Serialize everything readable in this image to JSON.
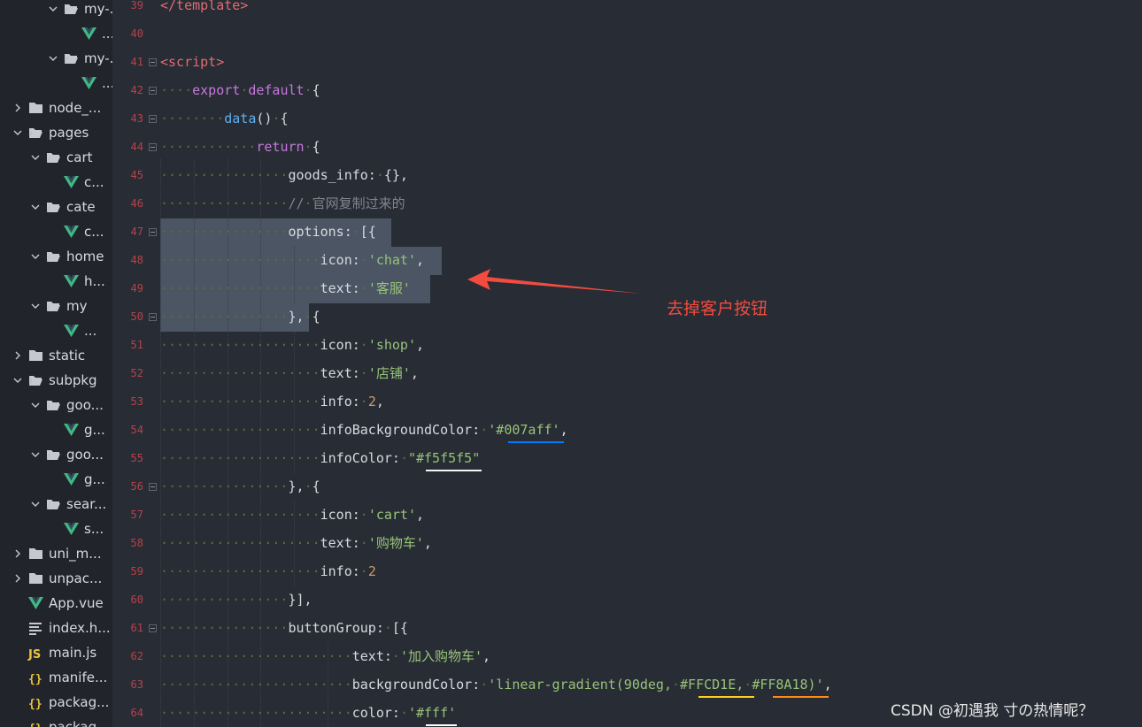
{
  "sidebar": {
    "items": [
      {
        "label": "my-...",
        "kind": "folder-open"
      },
      {
        "label": "...",
        "kind": "vue"
      },
      {
        "label": "my-...",
        "kind": "folder-open"
      },
      {
        "label": "...",
        "kind": "vue"
      },
      {
        "label": "node_...",
        "kind": "folder-closed"
      },
      {
        "label": "pages",
        "kind": "folder-open"
      },
      {
        "label": "cart",
        "kind": "folder-open"
      },
      {
        "label": "c...",
        "kind": "vue"
      },
      {
        "label": "cate",
        "kind": "folder-open"
      },
      {
        "label": "c...",
        "kind": "vue"
      },
      {
        "label": "home",
        "kind": "folder-open"
      },
      {
        "label": "h...",
        "kind": "vue"
      },
      {
        "label": "my",
        "kind": "folder-open"
      },
      {
        "label": "...",
        "kind": "vue"
      },
      {
        "label": "static",
        "kind": "folder-closed"
      },
      {
        "label": "subpkg",
        "kind": "folder-open"
      },
      {
        "label": "goo...",
        "kind": "folder-open"
      },
      {
        "label": "g...",
        "kind": "vue"
      },
      {
        "label": "goo...",
        "kind": "folder-open"
      },
      {
        "label": "g...",
        "kind": "vue"
      },
      {
        "label": "sear...",
        "kind": "folder-open"
      },
      {
        "label": "s...",
        "kind": "vue"
      },
      {
        "label": "uni_m...",
        "kind": "folder-closed"
      },
      {
        "label": "unpac...",
        "kind": "folder-closed"
      },
      {
        "label": "App.vue",
        "kind": "vue"
      },
      {
        "label": "index.h...",
        "kind": "html"
      },
      {
        "label": "main.js",
        "kind": "js"
      },
      {
        "label": "manife...",
        "kind": "json"
      },
      {
        "label": "packag...",
        "kind": "json"
      },
      {
        "label": "packag...",
        "kind": "json"
      }
    ]
  },
  "editor": {
    "lines": [
      {
        "num": "39",
        "fold": false,
        "tokens": [
          [
            "tag",
            "</template>"
          ]
        ]
      },
      {
        "num": "40",
        "fold": false,
        "tokens": []
      },
      {
        "num": "41",
        "fold": true,
        "tokens": [
          [
            "tag",
            "<script>"
          ]
        ]
      },
      {
        "num": "42",
        "fold": true,
        "tokens": [
          [
            "dots",
            "····"
          ],
          [
            "kw",
            "export"
          ],
          [
            "dots",
            "·"
          ],
          [
            "kw",
            "default"
          ],
          [
            "dots",
            "·"
          ],
          [
            "punc",
            "{"
          ]
        ]
      },
      {
        "num": "43",
        "fold": true,
        "tokens": [
          [
            "dots",
            "········"
          ],
          [
            "fn",
            "data"
          ],
          [
            "punc",
            "()"
          ],
          [
            "dots",
            "·"
          ],
          [
            "punc",
            "{"
          ]
        ]
      },
      {
        "num": "44",
        "fold": true,
        "tokens": [
          [
            "dots",
            "············"
          ],
          [
            "kw",
            "return"
          ],
          [
            "dots",
            "·"
          ],
          [
            "punc",
            "{"
          ]
        ]
      },
      {
        "num": "45",
        "fold": false,
        "tokens": [
          [
            "dots",
            "················"
          ],
          [
            "punc",
            "goods_info:"
          ],
          [
            "dots",
            "·"
          ],
          [
            "punc",
            "{},"
          ]
        ]
      },
      {
        "num": "46",
        "fold": false,
        "tokens": [
          [
            "dots",
            "················"
          ],
          [
            "cmt",
            "//"
          ],
          [
            "dots",
            "·"
          ],
          [
            "cmt",
            "官网复制过来的"
          ]
        ]
      },
      {
        "num": "47",
        "fold": true,
        "tokens": [
          [
            "dots",
            "················"
          ],
          [
            "punc",
            "options:"
          ],
          [
            "dots",
            "·"
          ],
          [
            "punc",
            "[{"
          ]
        ]
      },
      {
        "num": "48",
        "fold": false,
        "tokens": [
          [
            "dots",
            "····················"
          ],
          [
            "punc",
            "icon:"
          ],
          [
            "dots",
            "·"
          ],
          [
            "str",
            "'chat'"
          ],
          [
            "punc",
            ","
          ]
        ]
      },
      {
        "num": "49",
        "fold": false,
        "tokens": [
          [
            "dots",
            "····················"
          ],
          [
            "punc",
            "text:"
          ],
          [
            "dots",
            "·"
          ],
          [
            "str",
            "'客服'"
          ]
        ]
      },
      {
        "num": "50",
        "fold": true,
        "tokens": [
          [
            "dots",
            "················"
          ],
          [
            "punc",
            "},"
          ],
          [
            "dots",
            "·"
          ],
          [
            "punc",
            "{"
          ]
        ]
      },
      {
        "num": "51",
        "fold": false,
        "tokens": [
          [
            "dots",
            "····················"
          ],
          [
            "punc",
            "icon:"
          ],
          [
            "dots",
            "·"
          ],
          [
            "str",
            "'shop'"
          ],
          [
            "punc",
            ","
          ]
        ]
      },
      {
        "num": "52",
        "fold": false,
        "tokens": [
          [
            "dots",
            "····················"
          ],
          [
            "punc",
            "text:"
          ],
          [
            "dots",
            "·"
          ],
          [
            "str",
            "'店铺'"
          ],
          [
            "punc",
            ","
          ]
        ]
      },
      {
        "num": "53",
        "fold": false,
        "tokens": [
          [
            "dots",
            "····················"
          ],
          [
            "punc",
            "info:"
          ],
          [
            "dots",
            "·"
          ],
          [
            "num",
            "2"
          ],
          [
            "punc",
            ","
          ]
        ]
      },
      {
        "num": "54",
        "fold": false,
        "tokens": [
          [
            "dots",
            "····················"
          ],
          [
            "punc",
            "infoBackgroundColor:"
          ],
          [
            "dots",
            "·"
          ],
          [
            "str",
            "'#007aff'"
          ],
          [
            "punc",
            ","
          ]
        ]
      },
      {
        "num": "55",
        "fold": false,
        "tokens": [
          [
            "dots",
            "····················"
          ],
          [
            "punc",
            "infoColor:"
          ],
          [
            "dots",
            "·"
          ],
          [
            "str",
            "\"#f5f5f5\""
          ]
        ]
      },
      {
        "num": "56",
        "fold": true,
        "tokens": [
          [
            "dots",
            "················"
          ],
          [
            "punc",
            "},"
          ],
          [
            "dots",
            "·"
          ],
          [
            "punc",
            "{"
          ]
        ]
      },
      {
        "num": "57",
        "fold": false,
        "tokens": [
          [
            "dots",
            "····················"
          ],
          [
            "punc",
            "icon:"
          ],
          [
            "dots",
            "·"
          ],
          [
            "str",
            "'cart'"
          ],
          [
            "punc",
            ","
          ]
        ]
      },
      {
        "num": "58",
        "fold": false,
        "tokens": [
          [
            "dots",
            "····················"
          ],
          [
            "punc",
            "text:"
          ],
          [
            "dots",
            "·"
          ],
          [
            "str",
            "'购物车'"
          ],
          [
            "punc",
            ","
          ]
        ]
      },
      {
        "num": "59",
        "fold": false,
        "tokens": [
          [
            "dots",
            "····················"
          ],
          [
            "punc",
            "info:"
          ],
          [
            "dots",
            "·"
          ],
          [
            "num",
            "2"
          ]
        ]
      },
      {
        "num": "60",
        "fold": false,
        "tokens": [
          [
            "dots",
            "················"
          ],
          [
            "punc",
            "}],"
          ]
        ]
      },
      {
        "num": "61",
        "fold": true,
        "tokens": [
          [
            "dots",
            "················"
          ],
          [
            "punc",
            "buttonGroup:"
          ],
          [
            "dots",
            "·"
          ],
          [
            "punc",
            "[{"
          ]
        ]
      },
      {
        "num": "62",
        "fold": false,
        "tokens": [
          [
            "dots",
            "························"
          ],
          [
            "punc",
            "text:"
          ],
          [
            "dots",
            "·"
          ],
          [
            "str",
            "'加入购物车'"
          ],
          [
            "punc",
            ","
          ]
        ]
      },
      {
        "num": "63",
        "fold": false,
        "tokens": [
          [
            "dots",
            "························"
          ],
          [
            "punc",
            "backgroundColor:"
          ],
          [
            "dots",
            "·"
          ],
          [
            "str",
            "'linear-gradient(90deg,"
          ],
          [
            "dots",
            "·"
          ],
          [
            "str",
            "#FFCD1E,"
          ],
          [
            "dots",
            "·"
          ],
          [
            "str",
            "#FF8A18)'"
          ],
          [
            "punc",
            ","
          ]
        ]
      },
      {
        "num": "64",
        "fold": false,
        "tokens": [
          [
            "dots",
            "························"
          ],
          [
            "punc",
            "color:"
          ],
          [
            "dots",
            "·"
          ],
          [
            "str",
            "'#fff'"
          ]
        ]
      }
    ]
  },
  "annotation": {
    "text": "去掉客户按钮",
    "color": "#f24b3f"
  },
  "watermark": {
    "text": "CSDN @初遇我 寸の热情呢？"
  },
  "colors": {
    "sidebar_bg": "#21252b",
    "editor_bg": "#282c34",
    "line_number": "#b6434d",
    "keyword": "#c678dd",
    "function": "#61afef",
    "string": "#98c379",
    "number": "#d19a66",
    "selection": "#4b5563",
    "swatch_007aff": "#007aff",
    "swatch_f5f5f5": "#f5f5f5",
    "swatch_FFCD1E": "#FFCD1E",
    "swatch_FF8A18": "#FF8A18"
  }
}
